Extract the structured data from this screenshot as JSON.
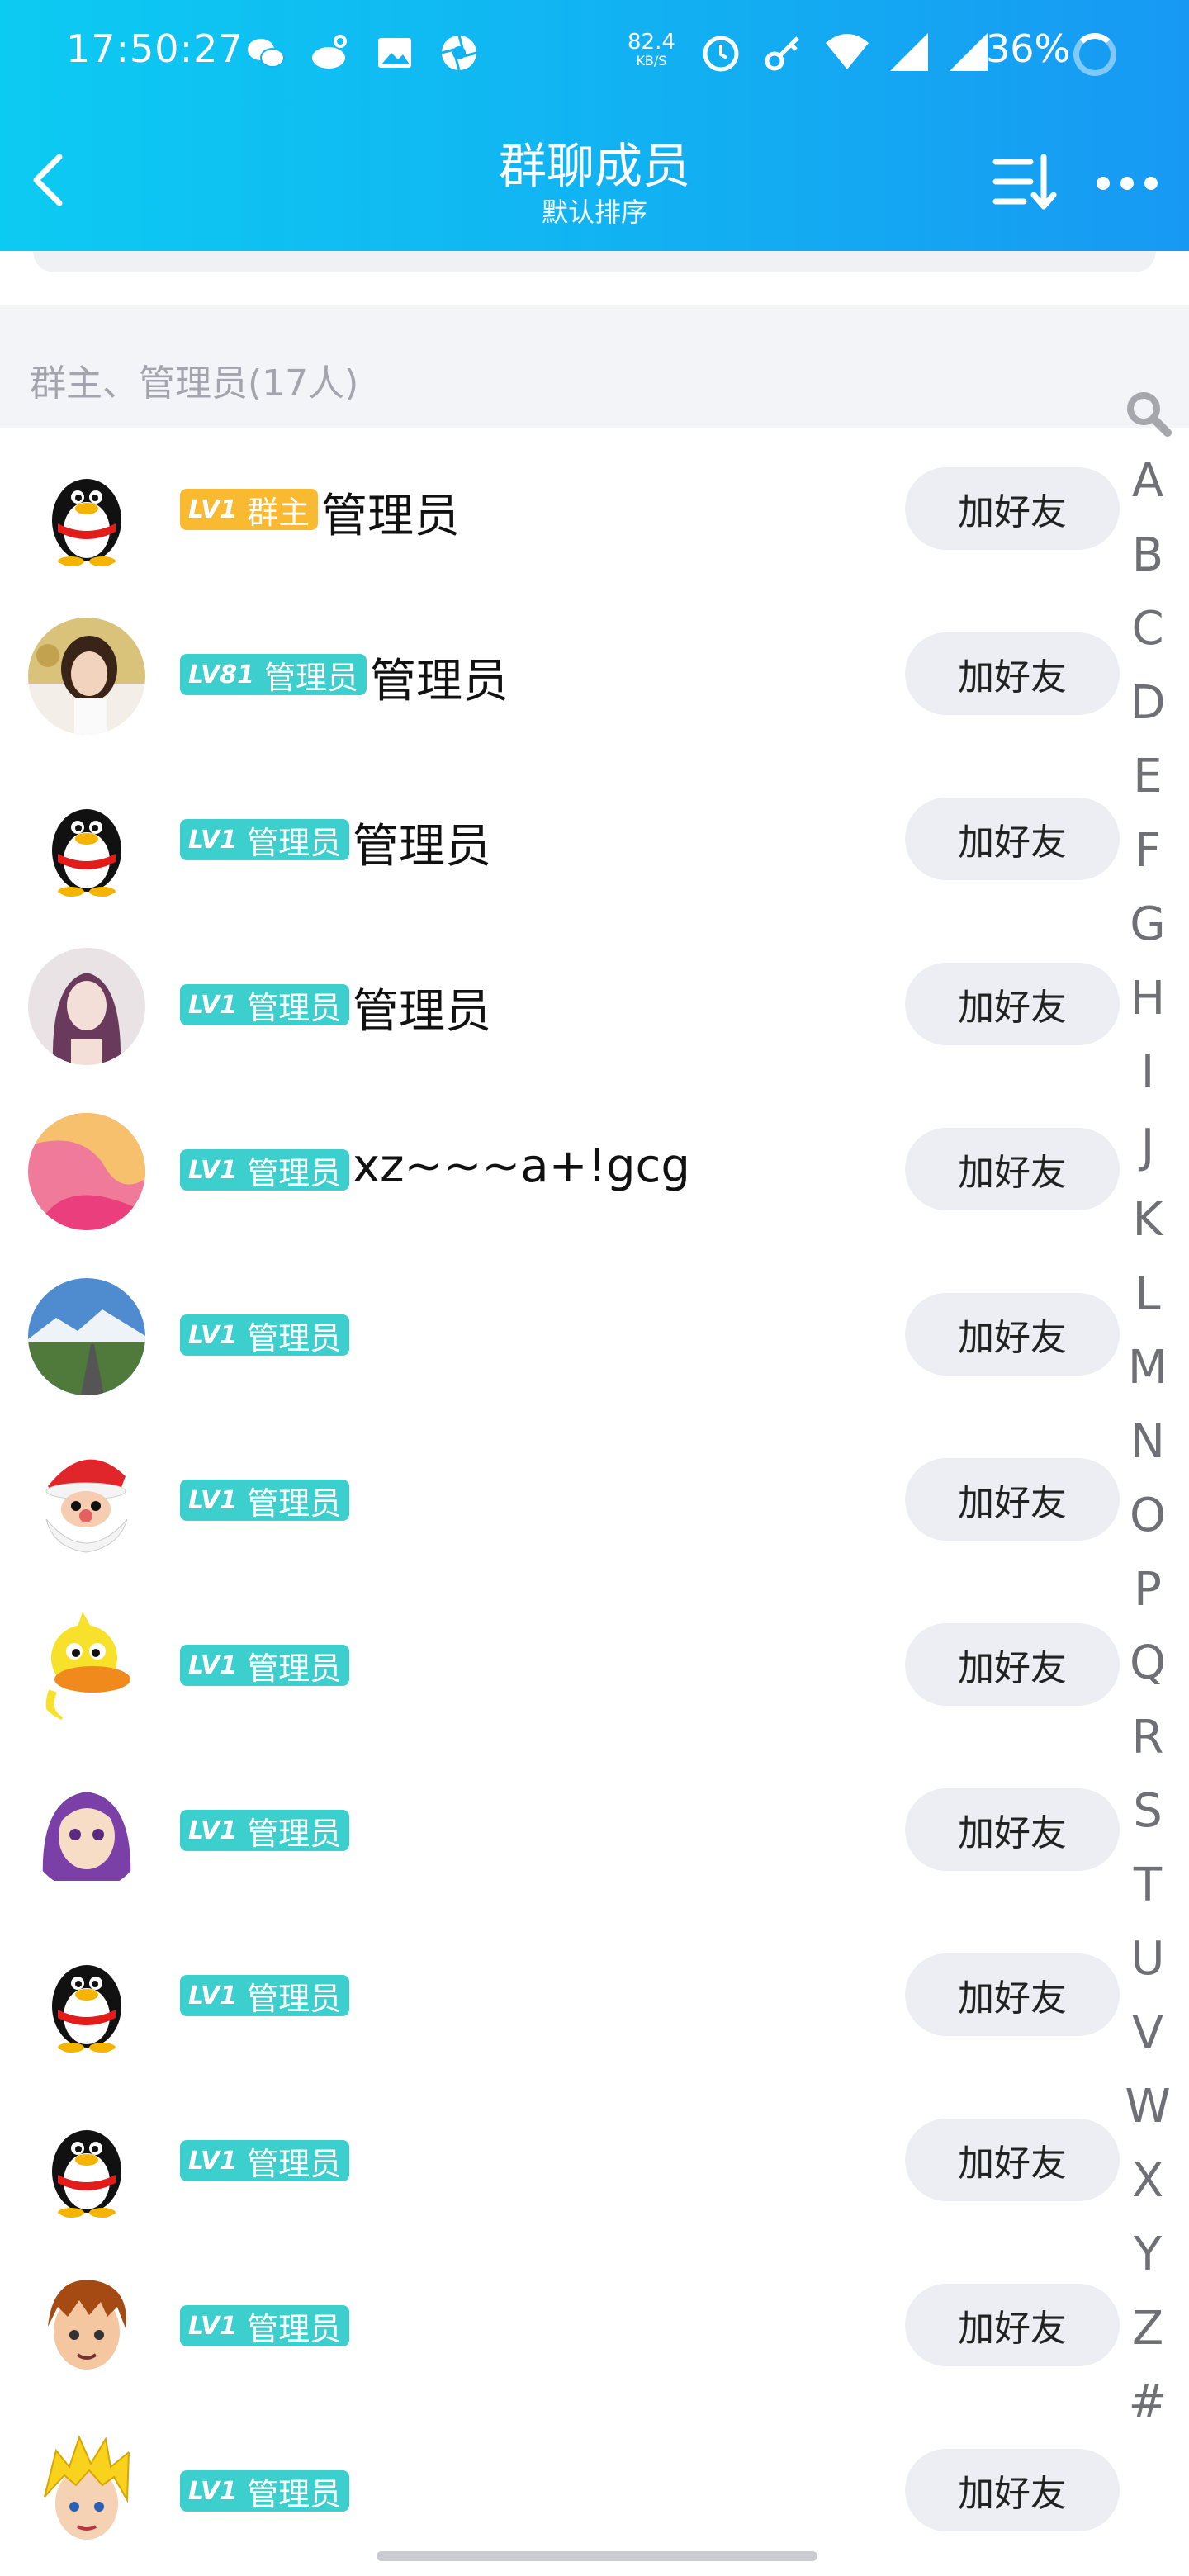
{
  "status_bar": {
    "time": "17:50:27",
    "net_speed": "82.4",
    "net_speed_unit": "KB/S",
    "battery": "36%",
    "left_icons": [
      "wechat-icon",
      "weibo-icon",
      "gallery-icon",
      "aperture-icon"
    ],
    "right_icons": [
      "alarm-icon",
      "key-icon",
      "wifi-icon",
      "signal-icon",
      "signal-icon"
    ]
  },
  "header": {
    "title": "群聊成员",
    "subtitle": "默认排序"
  },
  "section": {
    "title": "群主、管理员(17人)"
  },
  "add_friend_label": "加好友",
  "members": [
    {
      "level": "LV1",
      "role": "群主",
      "role_type": "owner",
      "name": "管理员",
      "avatar": "penguin-avatar"
    },
    {
      "level": "LV81",
      "role": "管理员",
      "role_type": "admin",
      "name": "管理员",
      "avatar": "photo-avatar-girl"
    },
    {
      "level": "LV1",
      "role": "管理员",
      "role_type": "admin",
      "name": "管理员",
      "avatar": "penguin-avatar"
    },
    {
      "level": "LV1",
      "role": "管理员",
      "role_type": "admin",
      "name": "管理员",
      "avatar": "photo-avatar-woman"
    },
    {
      "level": "LV1",
      "role": "管理员",
      "role_type": "admin",
      "name": "xz~~~a+!gcg",
      "avatar": "pink-avatar"
    },
    {
      "level": "LV1",
      "role": "管理员",
      "role_type": "admin",
      "name": "",
      "avatar": "landscape-avatar"
    },
    {
      "level": "LV1",
      "role": "管理员",
      "role_type": "admin",
      "name": "",
      "avatar": "santa-avatar"
    },
    {
      "level": "LV1",
      "role": "管理员",
      "role_type": "admin",
      "name": "",
      "avatar": "duck-avatar"
    },
    {
      "level": "LV1",
      "role": "管理员",
      "role_type": "admin",
      "name": "",
      "avatar": "purple-hair-avatar"
    },
    {
      "level": "LV1",
      "role": "管理员",
      "role_type": "admin",
      "name": "",
      "avatar": "penguin-avatar"
    },
    {
      "level": "LV1",
      "role": "管理员",
      "role_type": "admin",
      "name": "",
      "avatar": "penguin-avatar"
    },
    {
      "level": "LV1",
      "role": "管理员",
      "role_type": "admin",
      "name": "",
      "avatar": "brown-hair-avatar"
    },
    {
      "level": "LV1",
      "role": "管理员",
      "role_type": "admin",
      "name": "",
      "avatar": "blonde-avatar"
    }
  ],
  "index_letters": [
    "A",
    "B",
    "C",
    "D",
    "E",
    "F",
    "G",
    "H",
    "I",
    "J",
    "K",
    "L",
    "M",
    "N",
    "O",
    "P",
    "Q",
    "R",
    "S",
    "T",
    "U",
    "V",
    "W",
    "X",
    "Y",
    "Z",
    "#"
  ],
  "colors": {
    "header_start": "#0ccbf2",
    "header_end": "#1799f3",
    "owner_badge": "#f9b931",
    "admin_badge": "#3dcfce",
    "button_bg": "#edeef3"
  }
}
